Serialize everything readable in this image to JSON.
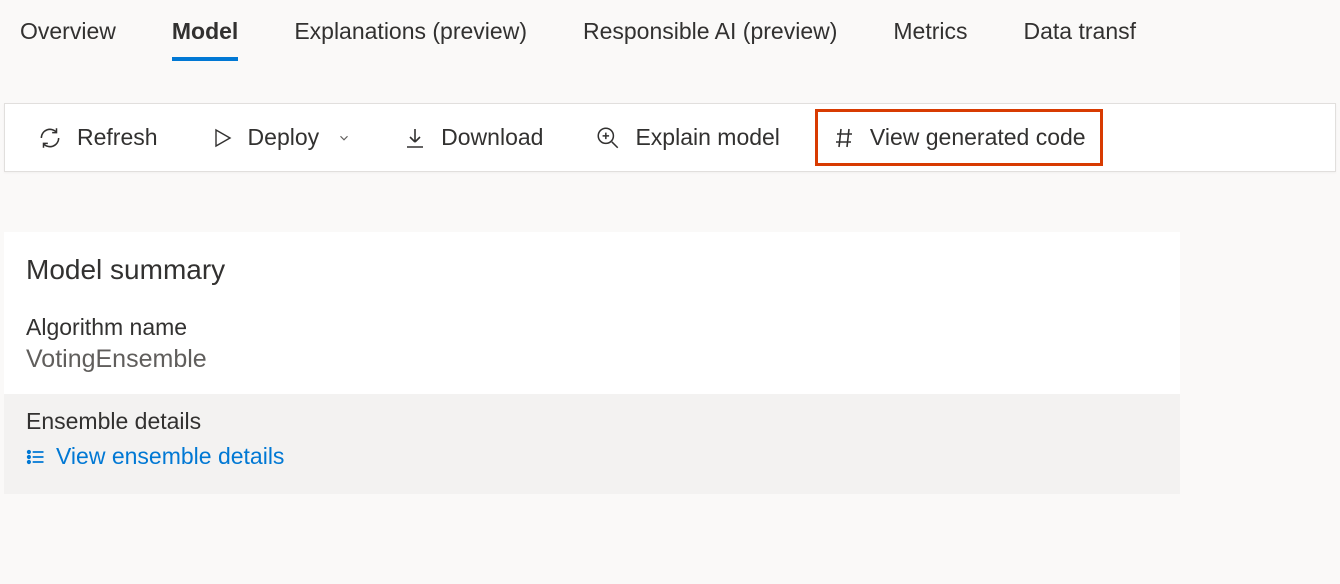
{
  "tabs": {
    "overview": "Overview",
    "model": "Model",
    "explanations": "Explanations (preview)",
    "responsible_ai": "Responsible AI (preview)",
    "metrics": "Metrics",
    "data_transf": "Data transf"
  },
  "toolbar": {
    "refresh": "Refresh",
    "deploy": "Deploy",
    "download": "Download",
    "explain_model": "Explain model",
    "view_code": "View generated code"
  },
  "summary": {
    "title": "Model summary",
    "algorithm_label": "Algorithm name",
    "algorithm_value": "VotingEnsemble",
    "ensemble_label": "Ensemble details",
    "ensemble_link": "View ensemble details"
  }
}
